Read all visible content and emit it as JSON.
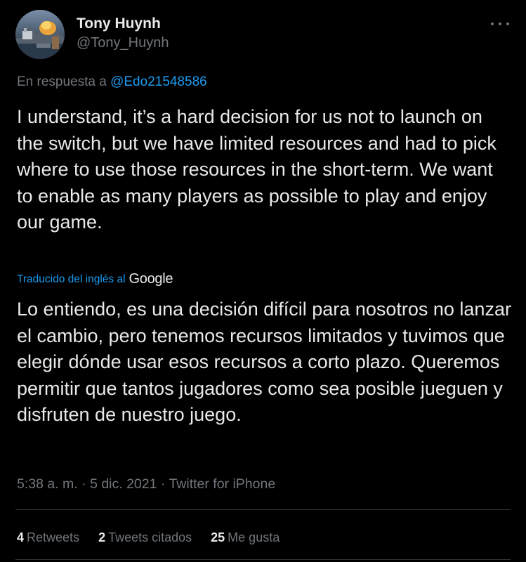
{
  "author": {
    "name": "Tony Huynh",
    "handle": "@Tony_Huynh",
    "avatar_icon": "avatar-landscape-image"
  },
  "more_icon": "more-options-icon",
  "reply": {
    "prefix": "En respuesta a",
    "mention": "@Edo21548586"
  },
  "text": "I understand, it’s a hard decision for us not to launch on the switch, but we have limited resources and had to pick where to use those resources in the short-term. We want to enable as many players as possible to play and enjoy our game.",
  "translation": {
    "label": "Traducido del inglés al",
    "provider": "Google",
    "text": "Lo entiendo, es una decisión difícil para nosotros no lanzar el cambio, pero tenemos recursos limitados y tuvimos que elegir dónde usar esos recursos a corto plazo. Queremos permitir que tantos jugadores como sea posible jueguen y disfruten de nuestro juego."
  },
  "meta": {
    "time": "5:38 a. m.",
    "separator": " · ",
    "date": "5 dic. 2021",
    "source": "Twitter for iPhone"
  },
  "stats": {
    "retweets_count": "4",
    "retweets_label": "Retweets",
    "quotes_count": "2",
    "quotes_label": "Tweets citados",
    "likes_count": "25",
    "likes_label": "Me gusta"
  },
  "colors": {
    "background": "#000000",
    "text": "#e7e9ea",
    "secondary": "#71767b",
    "accent": "#1d9bf0",
    "divider": "#2f3336"
  }
}
